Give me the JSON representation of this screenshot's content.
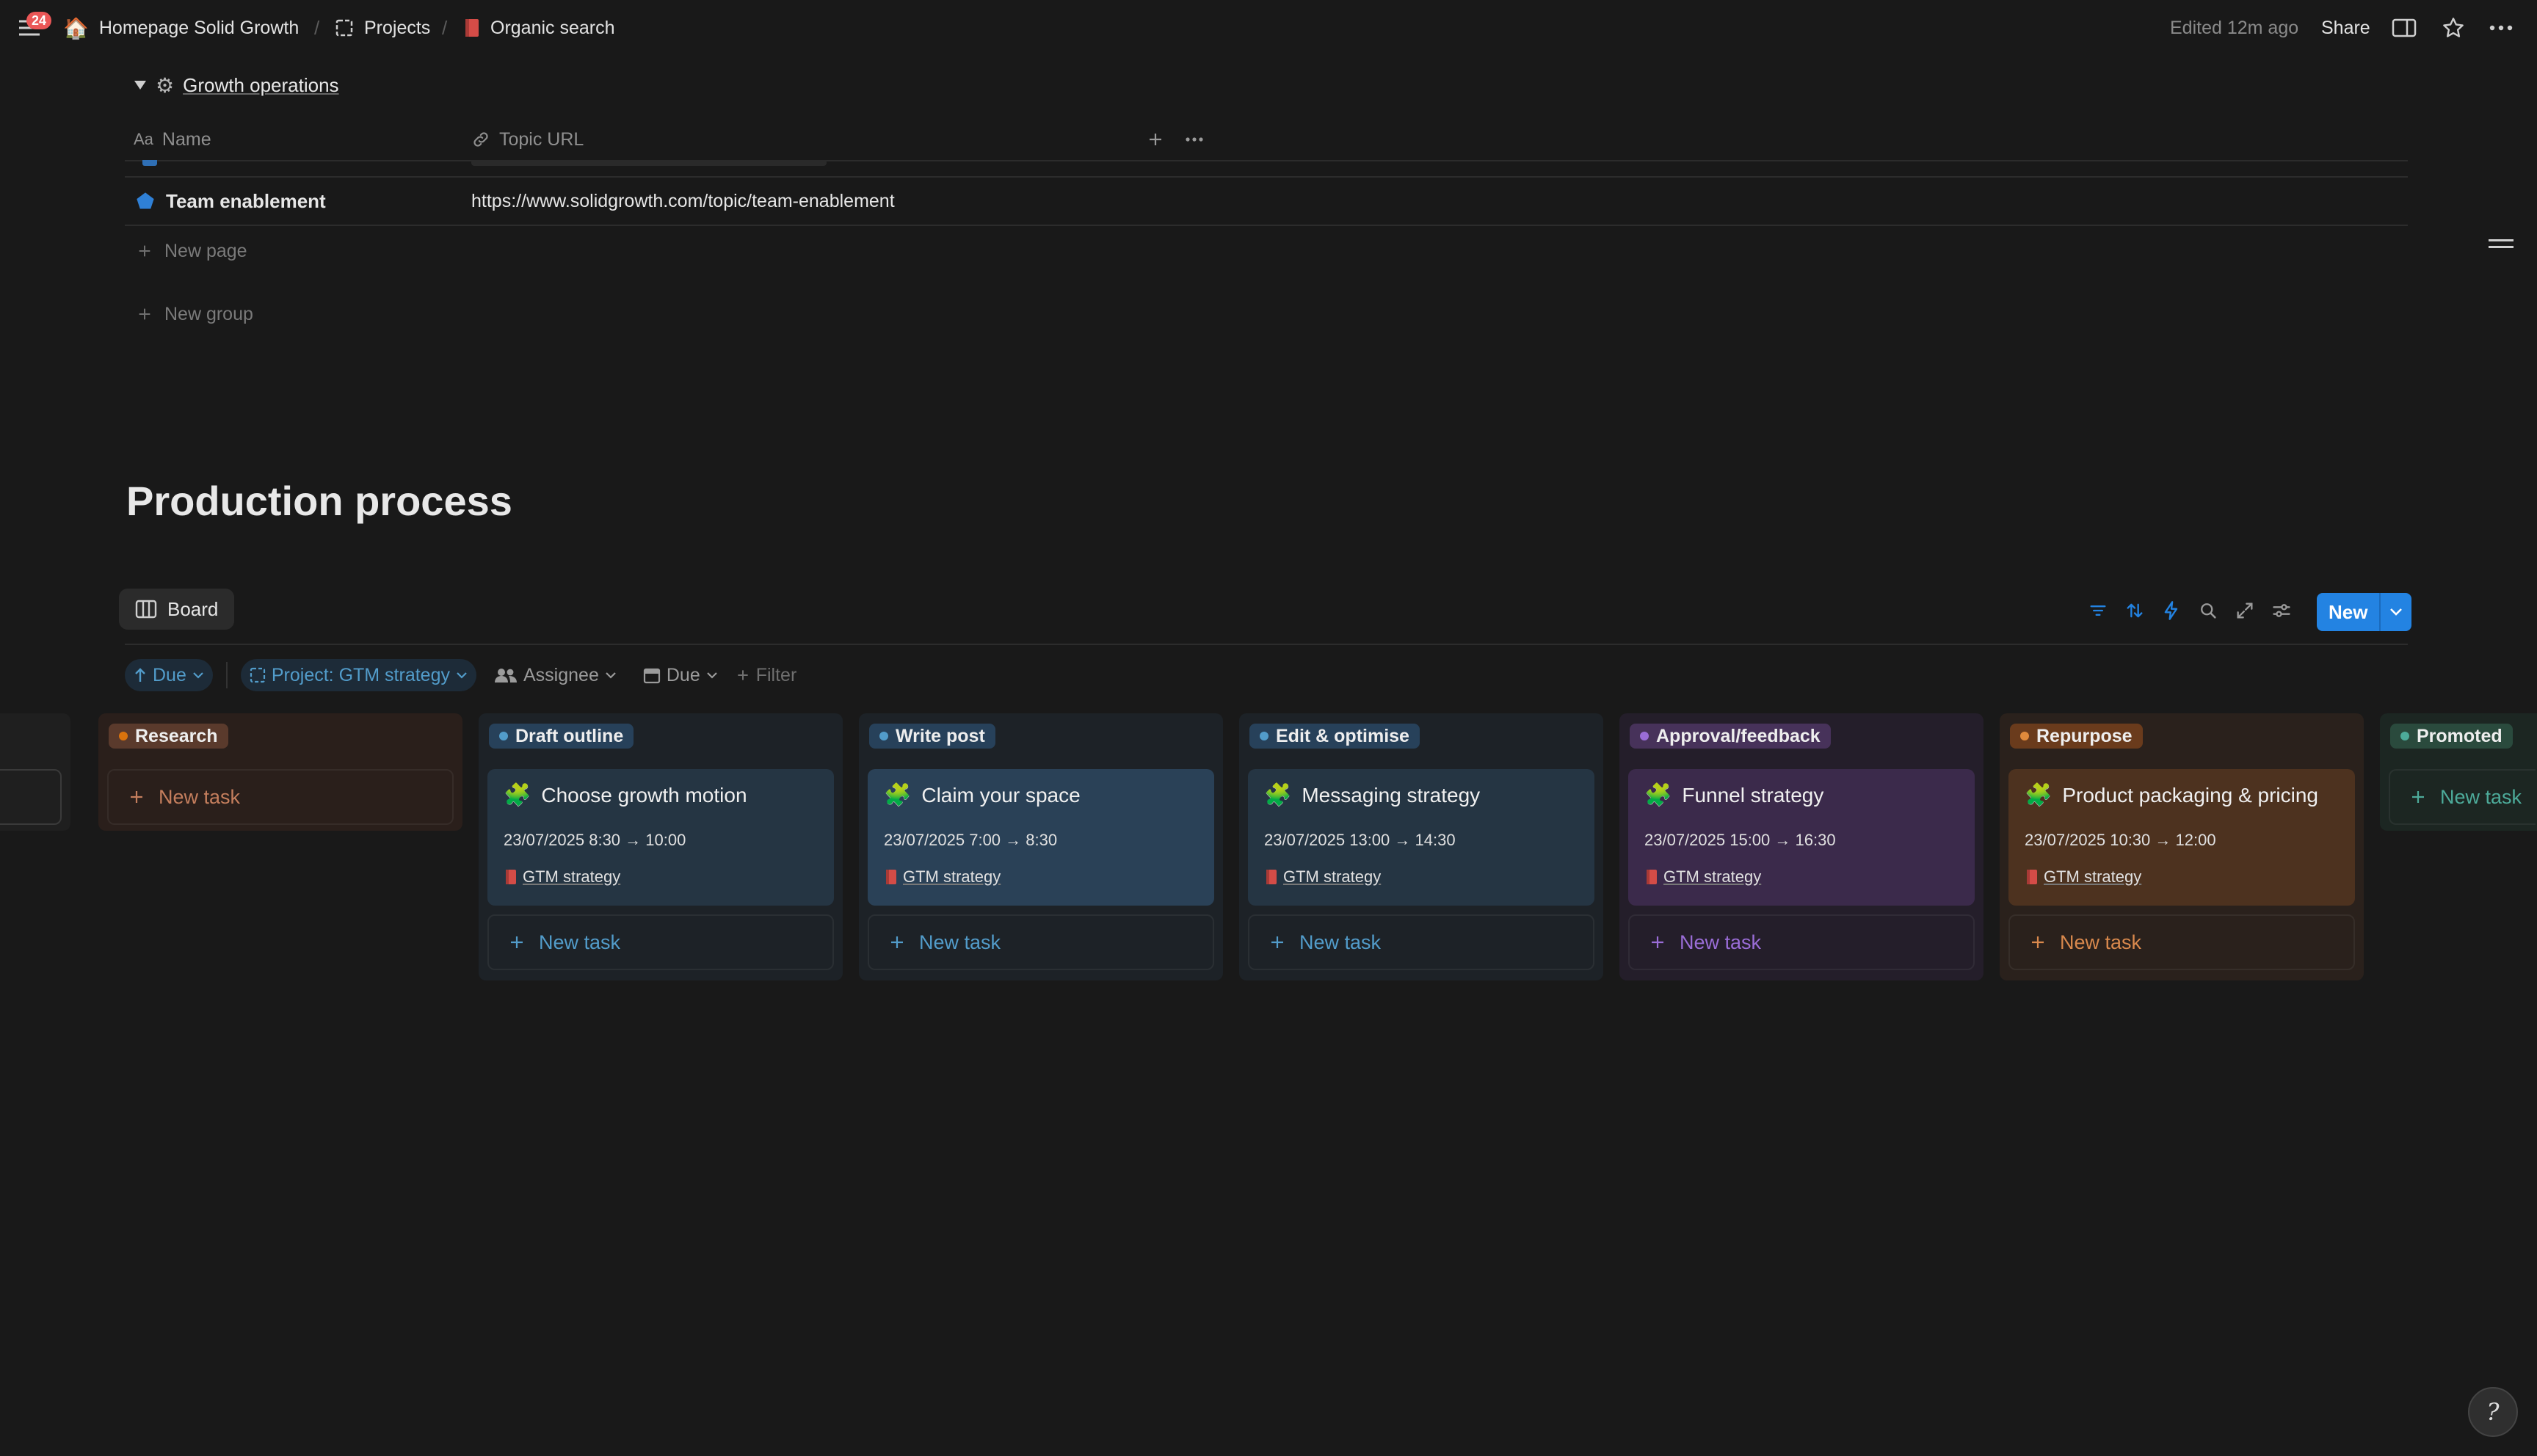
{
  "topbar": {
    "notification_count": "24",
    "breadcrumb": [
      "Homepage Solid Growth",
      "Projects",
      "Organic search"
    ],
    "edited": "Edited 12m ago",
    "share": "Share"
  },
  "table": {
    "group_title": "Growth operations",
    "col_name": "Name",
    "col_url": "Topic URL",
    "row": {
      "name": "Team enablement",
      "url": "https://www.solidgrowth.com/topic/team-enablement"
    },
    "new_page": "New page",
    "new_group": "New group"
  },
  "section_title": "Production process",
  "view": {
    "tab": "Board",
    "new": "New"
  },
  "filters": {
    "sort": "Due",
    "project": "Project: GTM strategy",
    "assignee": "Assignee",
    "due": "Due",
    "add": "Filter"
  },
  "board": {
    "new_task": "New task",
    "columns": [
      {
        "name": "Research",
        "dot": "#d9730d"
      },
      {
        "name": "Draft outline",
        "dot": "#529cca",
        "card": {
          "title": "Choose growth motion",
          "date": "23/07/2025 8:30 → 10:00",
          "project": "GTM strategy"
        }
      },
      {
        "name": "Write post",
        "dot": "#529cca",
        "card": {
          "title": "Claim your space",
          "date": "23/07/2025 7:00 → 8:30",
          "project": "GTM strategy"
        }
      },
      {
        "name": "Edit & optimise",
        "dot": "#529cca",
        "card": {
          "title": "Messaging strategy",
          "date": "23/07/2025 13:00 → 14:30",
          "project": "GTM strategy"
        }
      },
      {
        "name": "Approval/feedback",
        "dot": "#9a6dd7",
        "card": {
          "title": "Funnel strategy",
          "date": "23/07/2025 15:00 → 16:30",
          "project": "GTM strategy"
        }
      },
      {
        "name": "Repurpose",
        "dot": "#d9730d",
        "card": {
          "title": "Product packaging & pricing",
          "date": "23/07/2025 10:30 → 12:00",
          "project": "GTM strategy"
        }
      },
      {
        "name": "Promoted",
        "dot": "#4dab9a"
      }
    ]
  },
  "colors": {
    "accent": "#2383e2",
    "background": "#191919"
  },
  "icons": [
    "menu-icon",
    "house-icon",
    "projects-icon",
    "book-icon",
    "sidebar-toggle-icon",
    "star-icon",
    "more-icon",
    "gear-icon",
    "link-icon",
    "plus-icon",
    "board-icon",
    "filter-icon",
    "sort-icon",
    "lightning-icon",
    "search-icon",
    "expand-icon",
    "settings-icon",
    "puzzle-icon",
    "help-icon"
  ]
}
